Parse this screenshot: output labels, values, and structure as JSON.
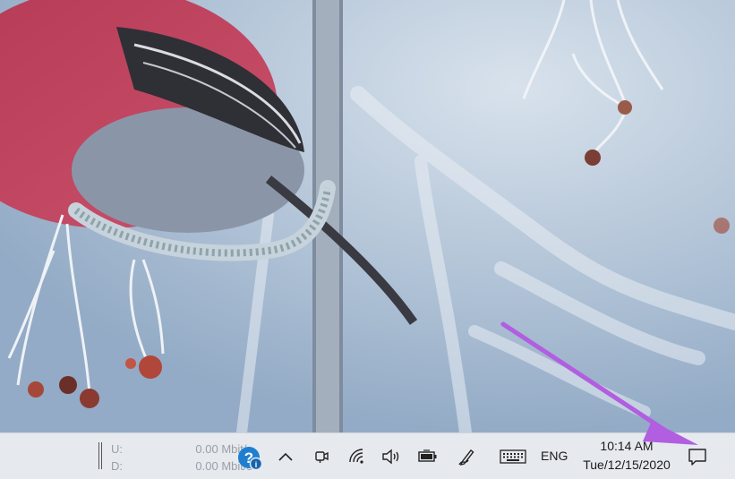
{
  "taskbar": {
    "network": {
      "upload_label": "U:",
      "download_label": "D:",
      "upload_value": "0.00 Mbit/s",
      "download_value": "0.00 Mbit/s"
    },
    "tray": {
      "icons": [
        "help-icon",
        "chevron-up-icon",
        "meet-now-icon",
        "wifi-icon",
        "speaker-icon",
        "battery-icon",
        "pen-icon",
        "keyboard-icon"
      ],
      "language": "ENG",
      "time": "10:14 AM",
      "date": "Tue/12/15/2020",
      "notification_icon": "action-center-icon"
    }
  },
  "colors": {
    "taskbar_bg": "#e6e9ee",
    "annotation_arrow": "#b15ee0",
    "help_badge": "#1e7fd1"
  }
}
